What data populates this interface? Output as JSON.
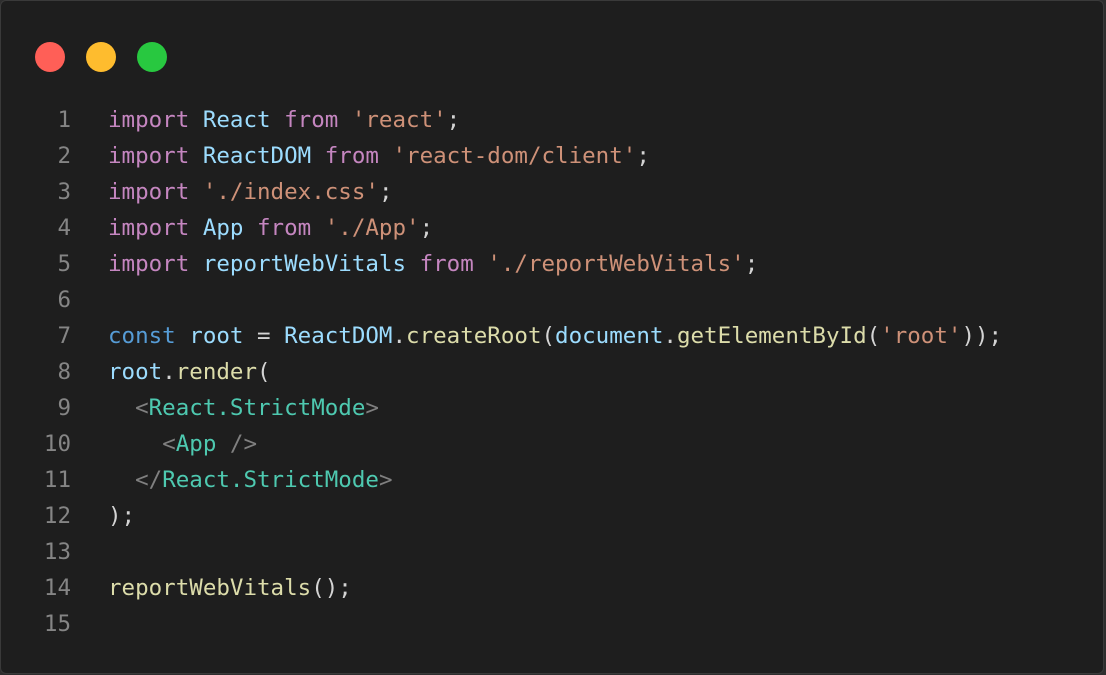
{
  "window": {
    "traffic_lights": [
      {
        "name": "close",
        "color": "#ff5f57"
      },
      {
        "name": "minimize",
        "color": "#febc2e"
      },
      {
        "name": "zoom",
        "color": "#28c840"
      }
    ]
  },
  "editor": {
    "lines": [
      {
        "number": "1",
        "tokens": [
          [
            "kw",
            "import"
          ],
          [
            "pun",
            " "
          ],
          [
            "id",
            "React"
          ],
          [
            "pun",
            " "
          ],
          [
            "kw",
            "from"
          ],
          [
            "pun",
            " "
          ],
          [
            "str",
            "'react'"
          ],
          [
            "pun",
            ";"
          ]
        ]
      },
      {
        "number": "2",
        "tokens": [
          [
            "kw",
            "import"
          ],
          [
            "pun",
            " "
          ],
          [
            "id",
            "ReactDOM"
          ],
          [
            "pun",
            " "
          ],
          [
            "kw",
            "from"
          ],
          [
            "pun",
            " "
          ],
          [
            "str",
            "'react-dom/client'"
          ],
          [
            "pun",
            ";"
          ]
        ]
      },
      {
        "number": "3",
        "tokens": [
          [
            "kw",
            "import"
          ],
          [
            "pun",
            " "
          ],
          [
            "str",
            "'./index.css'"
          ],
          [
            "pun",
            ";"
          ]
        ]
      },
      {
        "number": "4",
        "tokens": [
          [
            "kw",
            "import"
          ],
          [
            "pun",
            " "
          ],
          [
            "id",
            "App"
          ],
          [
            "pun",
            " "
          ],
          [
            "kw",
            "from"
          ],
          [
            "pun",
            " "
          ],
          [
            "str",
            "'./App'"
          ],
          [
            "pun",
            ";"
          ]
        ]
      },
      {
        "number": "5",
        "tokens": [
          [
            "kw",
            "import"
          ],
          [
            "pun",
            " "
          ],
          [
            "id",
            "reportWebVitals"
          ],
          [
            "pun",
            " "
          ],
          [
            "kw",
            "from"
          ],
          [
            "pun",
            " "
          ],
          [
            "str",
            "'./reportWebVitals'"
          ],
          [
            "pun",
            ";"
          ]
        ]
      },
      {
        "number": "6",
        "tokens": []
      },
      {
        "number": "7",
        "tokens": [
          [
            "dec",
            "const"
          ],
          [
            "pun",
            " "
          ],
          [
            "id",
            "root"
          ],
          [
            "pun",
            " = "
          ],
          [
            "id",
            "ReactDOM"
          ],
          [
            "pun",
            "."
          ],
          [
            "fn",
            "createRoot"
          ],
          [
            "pun",
            "("
          ],
          [
            "id",
            "document"
          ],
          [
            "pun",
            "."
          ],
          [
            "fn",
            "getElementById"
          ],
          [
            "pun",
            "("
          ],
          [
            "str",
            "'root'"
          ],
          [
            "pun",
            "));"
          ]
        ]
      },
      {
        "number": "8",
        "tokens": [
          [
            "id",
            "root"
          ],
          [
            "pun",
            "."
          ],
          [
            "fn",
            "render"
          ],
          [
            "pun",
            "("
          ]
        ]
      },
      {
        "number": "9",
        "tokens": [
          [
            "pun",
            "  "
          ],
          [
            "br",
            "<"
          ],
          [
            "tag",
            "React.StrictMode"
          ],
          [
            "br",
            ">"
          ]
        ]
      },
      {
        "number": "10",
        "tokens": [
          [
            "pun",
            "    "
          ],
          [
            "br",
            "<"
          ],
          [
            "tag",
            "App"
          ],
          [
            "pun",
            " "
          ],
          [
            "br",
            "/>"
          ]
        ]
      },
      {
        "number": "11",
        "tokens": [
          [
            "pun",
            "  "
          ],
          [
            "br",
            "</"
          ],
          [
            "tag",
            "React.StrictMode"
          ],
          [
            "br",
            ">"
          ]
        ]
      },
      {
        "number": "12",
        "tokens": [
          [
            "pun",
            ");"
          ]
        ]
      },
      {
        "number": "13",
        "tokens": []
      },
      {
        "number": "14",
        "tokens": [
          [
            "fn",
            "reportWebVitals"
          ],
          [
            "pun",
            "();"
          ]
        ]
      },
      {
        "number": "15",
        "tokens": []
      }
    ]
  }
}
